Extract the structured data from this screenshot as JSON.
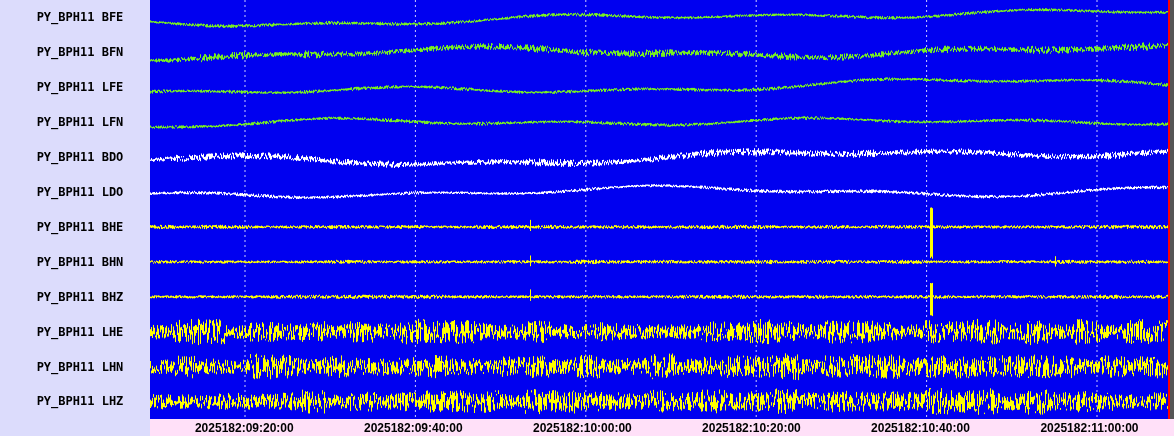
{
  "channels": [
    {
      "name": "PY_BPH11 BFE",
      "kind": "drift",
      "color": "#77ee22"
    },
    {
      "name": "PY_BPH11 BFN",
      "kind": "thick-drift",
      "color": "#77ee22"
    },
    {
      "name": "PY_BPH11 LFE",
      "kind": "drift",
      "color": "#77ee22"
    },
    {
      "name": "PY_BPH11 LFN",
      "kind": "drift",
      "color": "#77ee22"
    },
    {
      "name": "PY_BPH11 BDO",
      "kind": "thick-drift",
      "color": "#ffffff"
    },
    {
      "name": "PY_BPH11 LDO",
      "kind": "drift",
      "color": "#ffffff"
    },
    {
      "name": "PY_BPH11 BHE",
      "kind": "spike",
      "color": "#ffff00"
    },
    {
      "name": "PY_BPH11 BHN",
      "kind": "spike",
      "color": "#ffff00"
    },
    {
      "name": "PY_BPH11 BHZ",
      "kind": "spike",
      "color": "#ffff00"
    },
    {
      "name": "PY_BPH11 LHE",
      "kind": "noise",
      "color": "#ffff00"
    },
    {
      "name": "PY_BPH11 LHN",
      "kind": "noise",
      "color": "#ffff00"
    },
    {
      "name": "PY_BPH11 LHZ",
      "kind": "noise",
      "color": "#ffff00"
    }
  ],
  "time_axis": {
    "labels": [
      "2025182:09:20:00",
      "2025182:09:40:00",
      "2025182:10:00:00",
      "2025182:10:20:00",
      "2025182:10:40:00",
      "2025182:11:00:00"
    ]
  }
}
